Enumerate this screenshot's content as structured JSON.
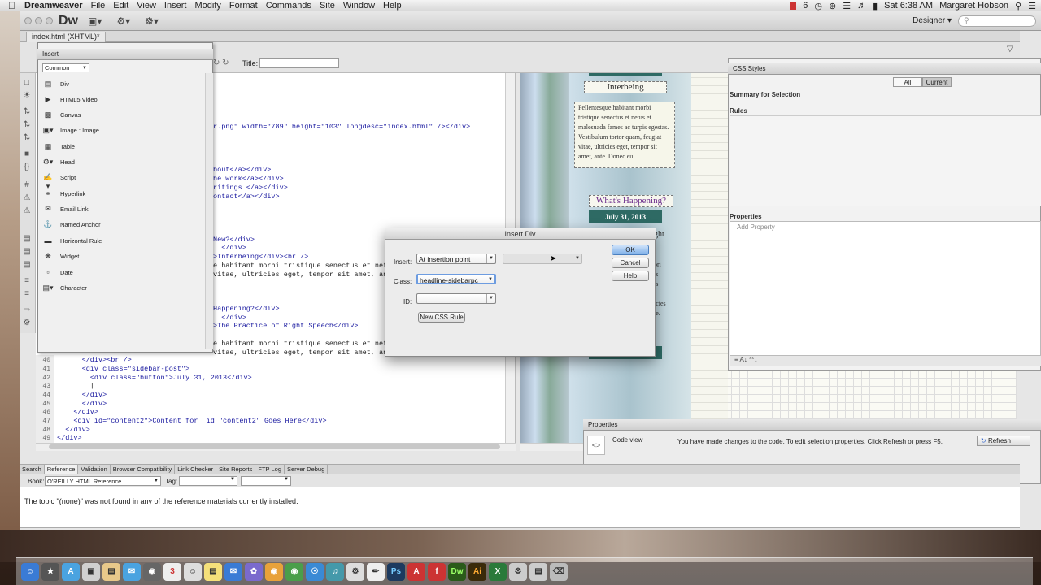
{
  "menubar": {
    "app": "Dreamweaver",
    "items": [
      "File",
      "Edit",
      "View",
      "Insert",
      "Modify",
      "Format",
      "Commands",
      "Site",
      "Window",
      "Help"
    ],
    "clock": "Sat 6:38 AM",
    "user": "Margaret Hobson",
    "badge": "6"
  },
  "app": {
    "logo": "Dw",
    "workspace": "Designer",
    "doc_tab": "index.html (XHTML)*",
    "title_label": "Title:",
    "title_value": ""
  },
  "code_upper": [
    {
      "text": "r.png\" width=\"789\" height=\"103\" longdesc=\"index.html\" /></div>"
    },
    {
      "text": "bout</a></div>"
    },
    {
      "text": "he work</a></div>"
    },
    {
      "text": "ritings </a></div>"
    },
    {
      "text": "ontact</a></div>"
    },
    {
      "text": "New?</div>"
    },
    {
      "text": "  </div>"
    },
    {
      "text": ">Interbeing</div><br />"
    },
    {
      "text": "e habitant morbi tristique senectus et netus"
    },
    {
      "text": "vitae, ultricies eget, tempor sit amet, ante."
    },
    {
      "text": "Happening?</div>"
    },
    {
      "text": "  </div>"
    },
    {
      "text": ">The Practice of Right Speech</div>"
    },
    {
      "text": "e habitant morbi tristique senectus et netus"
    },
    {
      "text": "vitae, ultricies eget, tempor sit amet, ante."
    }
  ],
  "code_lower": [
    {
      "num": "40",
      "text": "      </div><br />"
    },
    {
      "num": "41",
      "text": "      <div class=\"sidebar-post\">"
    },
    {
      "num": "42",
      "text": "        <div class=\"button\">July 31, 2013</div>"
    },
    {
      "num": "43",
      "text": "        |"
    },
    {
      "num": "44",
      "text": "      </div>"
    },
    {
      "num": "45",
      "text": "      </div>"
    },
    {
      "num": "46",
      "text": "    </div>"
    },
    {
      "num": "47",
      "text": "    <div id=\"content2\">Content for  id \"content2\" Goes Here</div>"
    },
    {
      "num": "48",
      "text": "  </div>"
    },
    {
      "num": "49",
      "text": "</div>"
    }
  ],
  "design": {
    "interbeing_title": "Interbeing",
    "interbeing_text": "Pellentesque habitant morbi tristique senectus et netus et malesuada fames ac turpis egestas. Vestibulum tortor quam, feugiat vitae, ultricies eget, tempor sit amet, ante. Donec eu.",
    "happening_title": "What's Happening?",
    "date_button": "July 31, 2013",
    "peek_heading": "ght",
    "peek_text": "ori\nis\nis\nr\nicies\nte."
  },
  "insert_panel": {
    "title": "Insert",
    "category": "Common",
    "items": [
      {
        "label": "Div",
        "icon": "div-icon"
      },
      {
        "label": "HTML5 Video",
        "icon": "video-icon"
      },
      {
        "label": "Canvas",
        "icon": "canvas-icon"
      },
      {
        "label": "Image : Image",
        "icon": "image-icon"
      },
      {
        "label": "Table",
        "icon": "table-icon"
      },
      {
        "label": "Head",
        "icon": "head-icon"
      },
      {
        "label": "Script",
        "icon": "script-icon"
      },
      {
        "label": "Hyperlink",
        "icon": "hyperlink-icon"
      },
      {
        "label": "Email Link",
        "icon": "email-icon"
      },
      {
        "label": "Named Anchor",
        "icon": "anchor-icon"
      },
      {
        "label": "Horizontal Rule",
        "icon": "hr-icon"
      },
      {
        "label": "Widget",
        "icon": "widget-icon"
      },
      {
        "label": "Date",
        "icon": "date-icon"
      },
      {
        "label": "Character",
        "icon": "character-icon"
      }
    ]
  },
  "css_panel": {
    "title": "CSS Styles",
    "all_tab": "All",
    "current_tab": "Current",
    "summary": "Summary for Selection",
    "rules": "Rules",
    "properties": "Properties",
    "add_property": "Add Property"
  },
  "properties_panel": {
    "title": "Properties",
    "mode": "Code view",
    "message": "You have made changes to the code. To edit selection properties, Click Refresh or press F5.",
    "refresh": "Refresh"
  },
  "results": {
    "tabs": [
      "Search",
      "Reference",
      "Validation",
      "Browser Compatibility",
      "Link Checker",
      "Site Reports",
      "FTP Log",
      "Server Debug"
    ],
    "active_tab": "Reference",
    "book_label": "Book:",
    "book_value": "O'REILLY HTML Reference",
    "tag_label": "Tag:",
    "message": "The topic \"(none)\" was not found in any of the reference materials currently installed."
  },
  "dialog": {
    "title": "Insert Div",
    "insert_label": "Insert:",
    "insert_value": "At insertion point",
    "class_label": "Class:",
    "class_value": "headline-sidebarpc",
    "id_label": "ID:",
    "id_value": "",
    "ok": "OK",
    "cancel": "Cancel",
    "help": "Help",
    "new_css_rule": "New CSS Rule"
  },
  "dock": {
    "apps": [
      "Ps",
      "Dw",
      "Ai"
    ]
  },
  "colors": {
    "accent_green": "#2e6a64",
    "heading_purple": "#6a2a8a",
    "code_blue": "#1a1aa0"
  }
}
